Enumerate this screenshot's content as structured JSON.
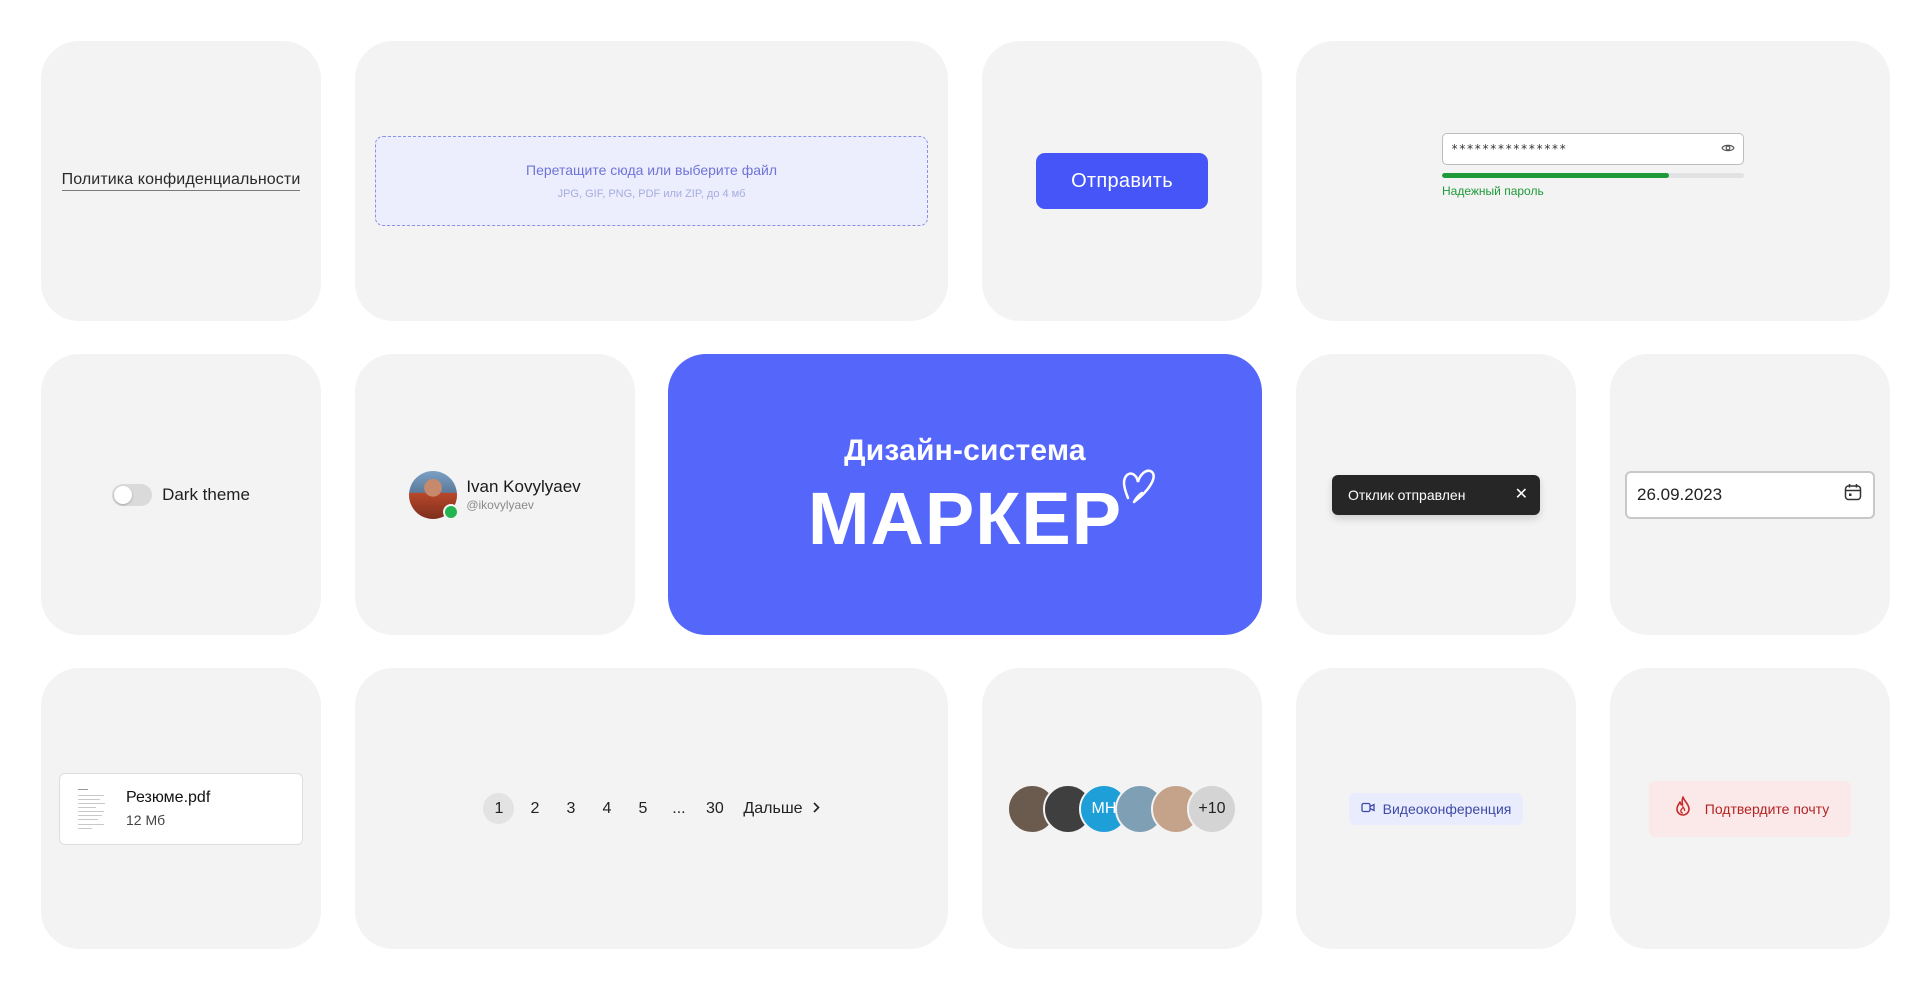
{
  "privacy": {
    "link": "Политика конфиденциальности"
  },
  "upload": {
    "title": "Перетащите сюда или выберите файл",
    "hint": "JPG, GIF, PNG, PDF или ZIP, до 4 мб"
  },
  "send_button": {
    "label": "Отправить",
    "color": "#4655f7"
  },
  "password": {
    "value": "***************",
    "strength_label": "Надежный пароль",
    "strength": 0.75,
    "strength_color": "#1f9a3a"
  },
  "theme_toggle": {
    "label": "Dark theme",
    "on": false
  },
  "user": {
    "name": "Ivan Kovylyaev",
    "handle": "@ikovylyaev",
    "status_color": "#23b552"
  },
  "hero": {
    "subtitle": "Дизайн-система",
    "logo": "МАРКЕР",
    "background": "#5567fb"
  },
  "toast": {
    "text": "Отклик отправлен",
    "close": "✕"
  },
  "date_field": {
    "value": "26.09.2023"
  },
  "file": {
    "name": "Резюме.pdf",
    "size": "12 Мб"
  },
  "pagination": {
    "pages": [
      "1",
      "2",
      "3",
      "4",
      "5",
      "...",
      "30"
    ],
    "active": "1",
    "next_label": "Дальше"
  },
  "avatars": {
    "items": [
      {
        "color": "#6b5a4e",
        "initials": ""
      },
      {
        "color": "#3f3f3f",
        "initials": ""
      },
      {
        "color": "#1f9fd8",
        "initials": "МН"
      },
      {
        "color": "#7f9fb5",
        "initials": ""
      },
      {
        "color": "#c5a38a",
        "initials": ""
      }
    ],
    "more": "+10"
  },
  "tag": {
    "label": "Видеоконференция"
  },
  "alert": {
    "text": "Подтвердите почту",
    "color": "#b42424"
  }
}
